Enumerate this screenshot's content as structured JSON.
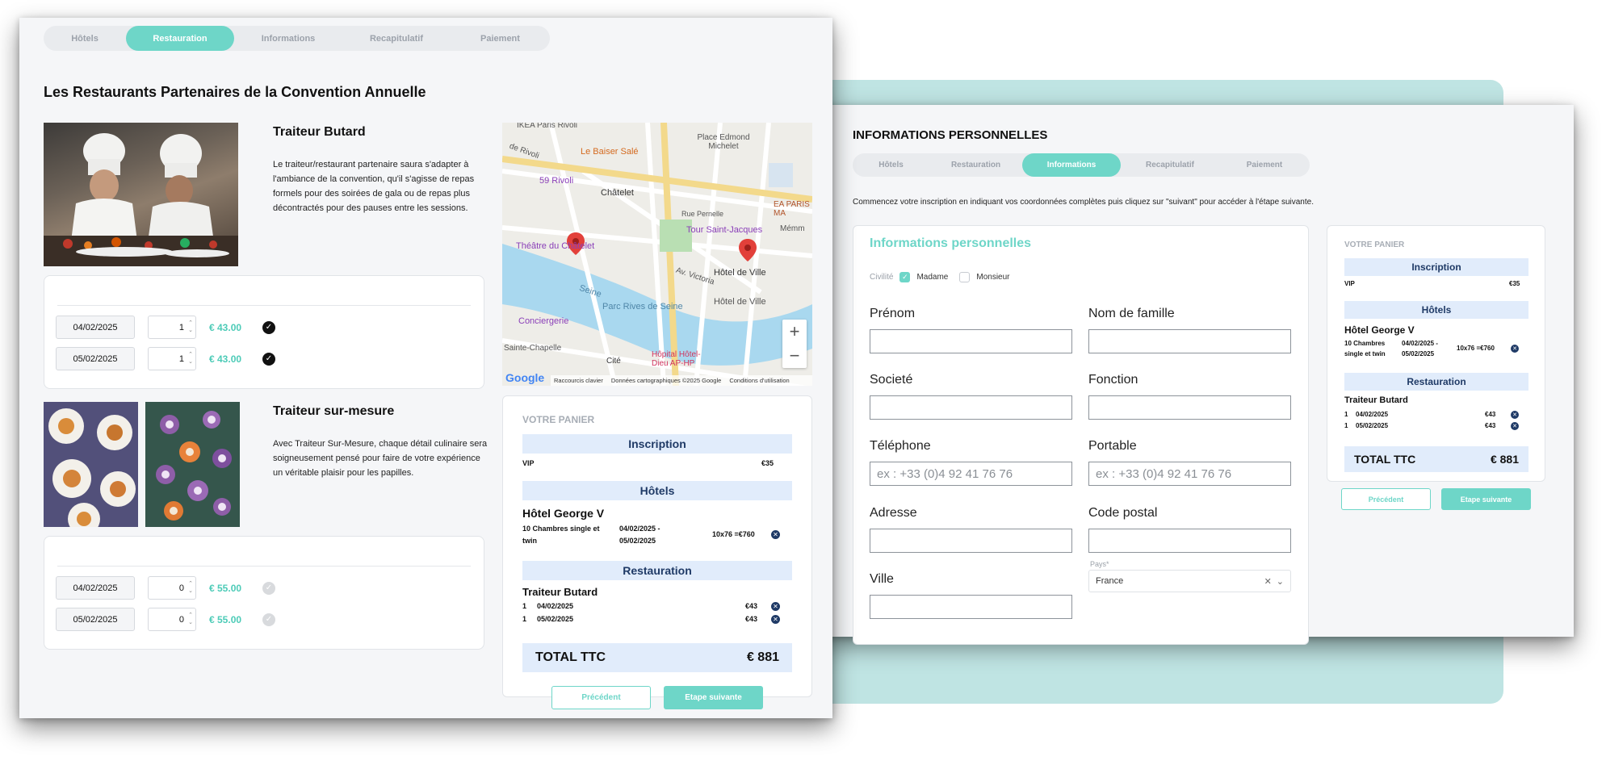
{
  "steps": [
    "Hôtels",
    "Restauration",
    "Informations",
    "Recapitulatif",
    "Paiement"
  ],
  "left": {
    "title": "Les Restaurants Partenaires de la Convention Annuelle",
    "restaurants": [
      {
        "name": "Traiteur Butard",
        "description": "Le traiteur/restaurant partenaire saura s'adapter à l'ambiance de la convention, qu'il s'agisse de repas formels pour des soirées de gala ou de repas plus décontractés pour des pauses entre les sessions.",
        "rows": [
          {
            "date": "04/02/2025",
            "qty": "1",
            "price": "€ 43.00",
            "checked": true
          },
          {
            "date": "05/02/2025",
            "qty": "1",
            "price": "€ 43.00",
            "checked": true
          }
        ]
      },
      {
        "name": "Traiteur sur-mesure",
        "description": "Avec Traiteur Sur-Mesure, chaque détail culinaire sera soigneusement pensé pour faire de votre expérience un véritable plaisir pour les papilles.",
        "rows": [
          {
            "date": "04/02/2025",
            "qty": "0",
            "price": "€ 55.00",
            "checked": false
          },
          {
            "date": "05/02/2025",
            "qty": "0",
            "price": "€ 55.00",
            "checked": false
          }
        ]
      }
    ],
    "map": {
      "labels": {
        "ikea": "IKEA Paris Rivoli",
        "baiser": "Le Baiser Salé",
        "rivoli": "59 Rivoli",
        "chatelet": "Châtelet",
        "theatre": "Théâtre du Châtelet",
        "tour": "Tour Saint-Jacques",
        "edmond": "Place Edmond Michelet",
        "pernelle": "Rue Pernelle",
        "victoria": "Av. Victoria",
        "hotelville": "Hôtel de Ville",
        "hotelville2": "Hôtel de Ville",
        "seine": "Seine",
        "parc": "Parc Rives de Seine",
        "conciergerie": "Conciergerie",
        "chapelle": "Sainte-Chapelle",
        "cite": "Cité",
        "hopital": "Hôpital Hôtel-Dieu AP-HP",
        "memm": "Mémm",
        "ea": "EA PARIS MA",
        "voltaire": "de Rivoli"
      },
      "footer": {
        "google": "Google",
        "shortcuts": "Raccourcis clavier",
        "data": "Données cartographiques ©2025 Google",
        "terms": "Conditions d'utilisation"
      },
      "zoom_in": "+",
      "zoom_out": "−"
    },
    "cart": {
      "title": "VOTRE PANIER",
      "sections": {
        "inscription": "Inscription",
        "hotels": "Hôtels",
        "restauration": "Restauration"
      },
      "vip_label": "VIP",
      "vip_price": "€35",
      "hotel_name": "Hôtel George V",
      "hotel_rooms": "10 Chambres single et twin",
      "hotel_dates": "04/02/2025 - 05/02/2025",
      "hotel_price": "10x76 =€760",
      "rest_name": "Traiteur Butard",
      "rest_lines": [
        {
          "qty": "1",
          "date": "04/02/2025",
          "price": "€43"
        },
        {
          "qty": "1",
          "date": "05/02/2025",
          "price": "€43"
        }
      ],
      "total_label": "TOTAL TTC",
      "total_value": "€ 881"
    },
    "prev_label": "Précédent",
    "next_label": "Etape suivante"
  },
  "right": {
    "title": "INFORMATIONS PERSONNELLES",
    "intro": "Commencez votre inscription en indiquant vos coordonnées complètes puis cliquez sur \"suivant\" pour accéder à l'étape suivante.",
    "form_title": "Informations personnelles",
    "civilite_label": "Civilité",
    "madame": "Madame",
    "monsieur": "Monsieur",
    "fields": {
      "prenom": "Prénom",
      "nom": "Nom de famille",
      "societe": "Societé",
      "fonction": "Fonction",
      "telephone": "Téléphone",
      "portable": "Portable",
      "adresse": "Adresse",
      "code_postal": "Code postal",
      "ville": "Ville",
      "pays": "Pays*"
    },
    "phone_placeholder": "ex : +33 (0)4 92 41 76 76",
    "mobile_placeholder": "ex : +33 (0)4 92 41 76 76",
    "pays_value": "France",
    "cart": {
      "title": "VOTRE PANIER",
      "sections": {
        "inscription": "Inscription",
        "hotels": "Hôtels",
        "restauration": "Restauration"
      },
      "vip_label": "VIP",
      "vip_price": "€35",
      "hotel_name": "Hôtel George V",
      "hotel_rooms": "10 Chambres single et twin",
      "hotel_dates": "04/02/2025 - 05/02/2025",
      "hotel_price": "10x76 =€760",
      "rest_name": "Traiteur Butard",
      "rest_lines": [
        {
          "qty": "1",
          "date": "04/02/2025",
          "price": "€43"
        },
        {
          "qty": "1",
          "date": "05/02/2025",
          "price": "€43"
        }
      ],
      "total_label": "TOTAL TTC",
      "total_value": "€ 881"
    },
    "prev_label": "Précédent",
    "next_label": "Etape suivante"
  },
  "colors": {
    "accent": "#6ed6c8",
    "navy": "#1f3a66",
    "band": "#e1ecfb",
    "backdrop": "#bfe4e3"
  }
}
